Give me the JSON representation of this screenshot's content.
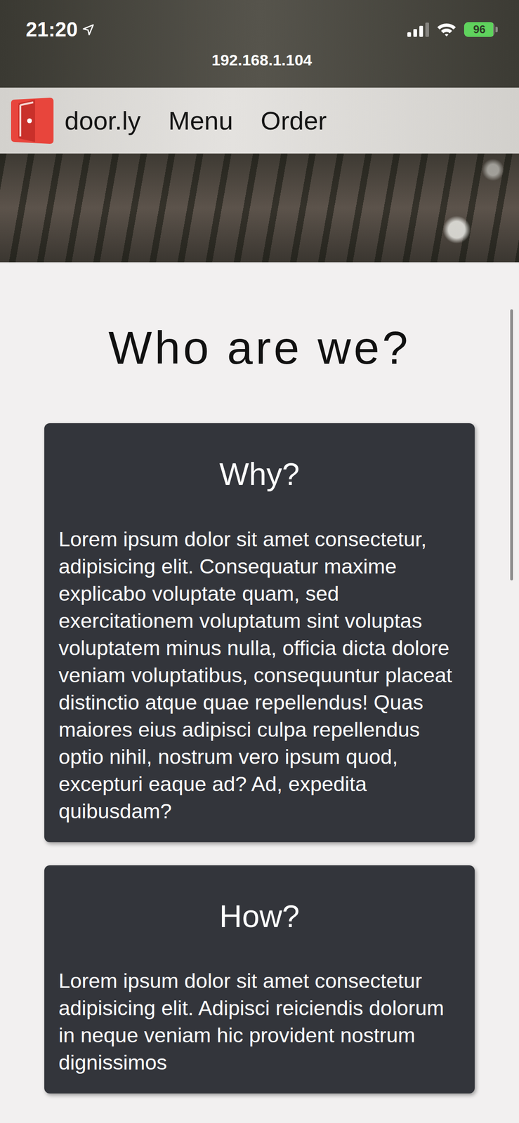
{
  "status_bar": {
    "time": "21:20",
    "signal": {
      "level": 0.75
    },
    "battery": {
      "text": "96",
      "level": 0.96
    }
  },
  "address_bar": {
    "url": "192.168.1.104"
  },
  "navbar": {
    "brand": "door.ly",
    "links": [
      {
        "label": "Menu"
      },
      {
        "label": "Order"
      }
    ]
  },
  "heading": "Who are we?",
  "cards": [
    {
      "title": "Why?",
      "text": "Lorem ipsum dolor sit amet consectetur, adipisicing elit. Consequatur maxime explicabo voluptate quam, sed exercitationem voluptatum sint voluptas voluptatem minus nulla, officia dicta dolore veniam voluptatibus, consequuntur placeat distinctio atque quae repellendus! Quas maiores eius adipisci culpa repellendus optio nihil, nostrum vero ipsum quod, excepturi eaque ad? Ad, expedita quibusdam?"
    },
    {
      "title": "How?",
      "text": "Lorem ipsum dolor sit amet consectetur adipisicing elit. Adipisci reiciendis dolorum in neque veniam hic provident nostrum dignissimos"
    }
  ]
}
